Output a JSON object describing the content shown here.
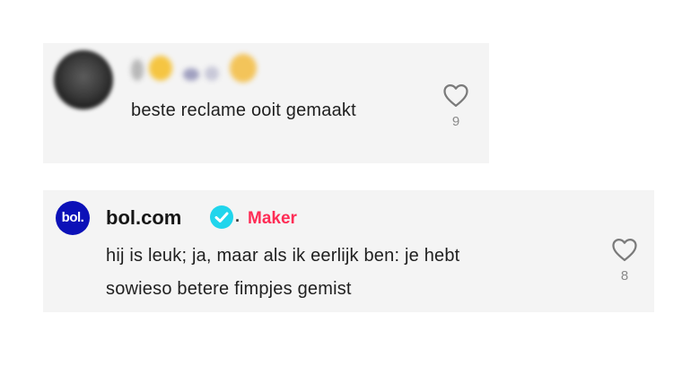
{
  "comments": [
    {
      "author": "",
      "text": "beste reclame ooit gemaakt",
      "likes": "9",
      "like_icon": "heart-outline-icon"
    },
    {
      "author": "bol.com",
      "avatar_text": "bol.",
      "verified_icon": "verified-check-icon",
      "separator": "·",
      "badge": "Maker",
      "text_lines": [
        "hij is leuk; ja, maar als ik eerlijk ben: je hebt",
        "sowieso betere fimpjes gemist"
      ],
      "likes": "8",
      "like_icon": "heart-outline-icon"
    }
  ],
  "colors": {
    "card_background": "#f4f4f4",
    "badge": "#fe2c55",
    "verified": "#20d5ec",
    "logo_background": "#0c11b8"
  }
}
